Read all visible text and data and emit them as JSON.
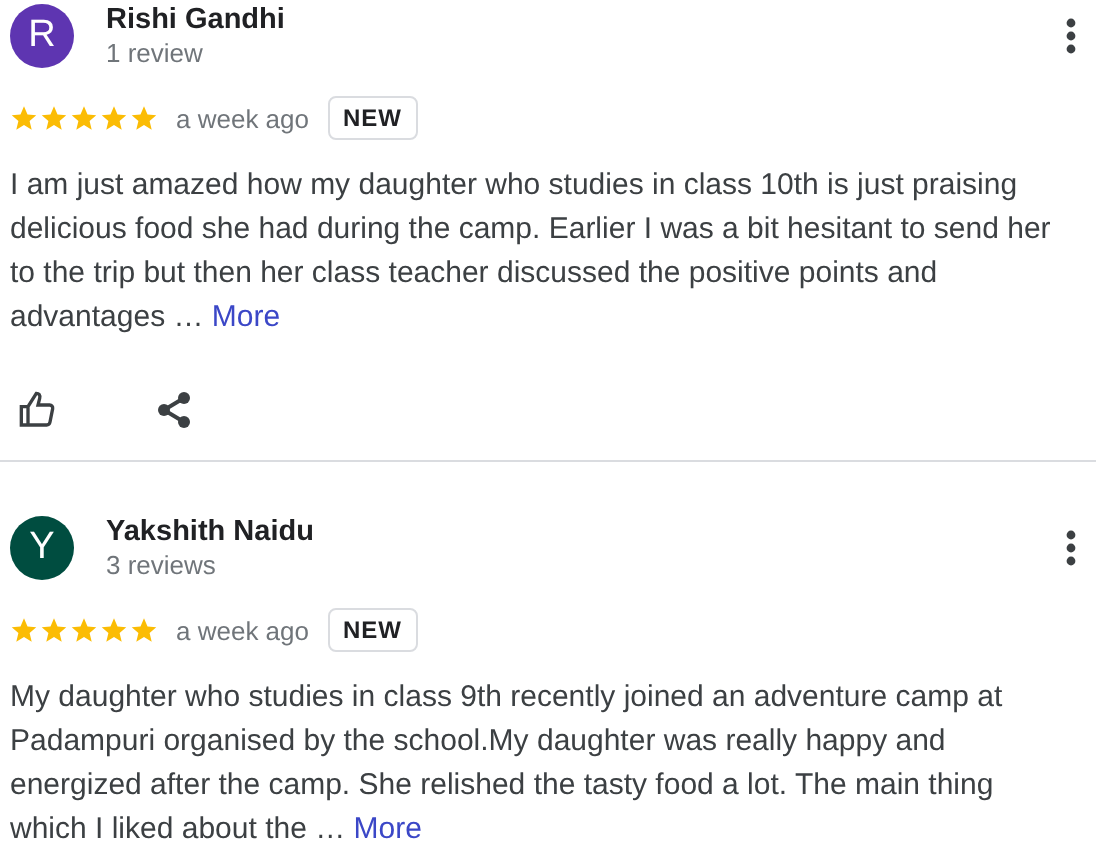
{
  "reviews": [
    {
      "initial": "R",
      "color": "#5e35b1",
      "name": "Rishi Gandhi",
      "count": "1 review",
      "stars": 5,
      "time": "a week ago",
      "badge": "NEW",
      "text": "I am just amazed how my daughter who studies in class 10th is just praising delicious food she had during the camp. Earlier I was a bit hesitant to send her to the trip but then her class teacher discussed the positive points and advantages …",
      "more": "More",
      "actions": true
    },
    {
      "initial": "Y",
      "color": "#004d40",
      "name": "Yakshith Naidu",
      "count": "3 reviews",
      "stars": 5,
      "time": "a week ago",
      "badge": "NEW",
      "text": "My daughter who studies in class 9th recently joined an adventure camp at Padampuri organised by the school.My daughter was really happy and energized after the camp. She relished the tasty food a lot. The main thing which I liked about the …",
      "more": "More",
      "actions": false
    }
  ]
}
